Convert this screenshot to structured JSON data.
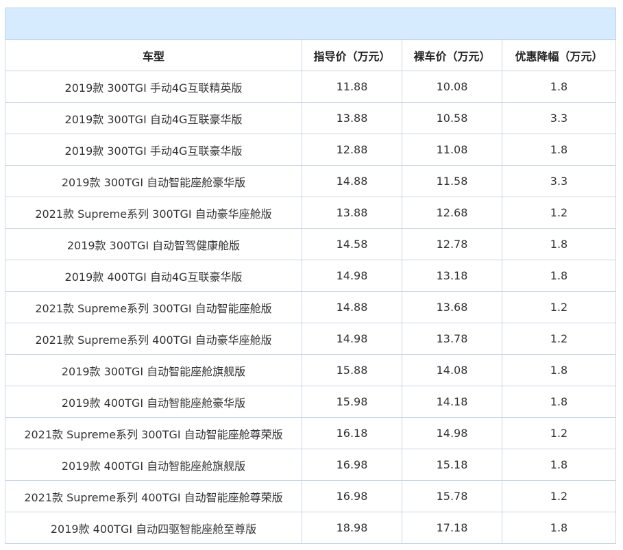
{
  "table": {
    "headers": [
      "车型",
      "指导价（万元）",
      "裸车价（万元）",
      "优惠降幅（万元）"
    ],
    "rows": [
      [
        "2019款 300TGI 手动4G互联精英版",
        "11.88",
        "10.08",
        "1.8"
      ],
      [
        "2019款 300TGI 自动4G互联豪华版",
        "13.88",
        "10.58",
        "3.3"
      ],
      [
        "2019款 300TGI 手动4G互联豪华版",
        "12.88",
        "11.08",
        "1.8"
      ],
      [
        "2019款 300TGI 自动智能座舱豪华版",
        "14.88",
        "11.58",
        "3.3"
      ],
      [
        "2021款 Supreme系列 300TGI 自动豪华座舱版",
        "13.88",
        "12.68",
        "1.2"
      ],
      [
        "2019款 300TGI 自动智驾健康舱版",
        "14.58",
        "12.78",
        "1.8"
      ],
      [
        "2019款 400TGI 自动4G互联豪华版",
        "14.98",
        "13.18",
        "1.8"
      ],
      [
        "2021款 Supreme系列 300TGI 自动智能座舱版",
        "14.88",
        "13.68",
        "1.2"
      ],
      [
        "2021款 Supreme系列 400TGI 自动豪华座舱版",
        "14.98",
        "13.78",
        "1.2"
      ],
      [
        "2019款 300TGI 自动智能座舱旗舰版",
        "15.88",
        "14.08",
        "1.8"
      ],
      [
        "2019款 400TGI 自动智能座舱豪华版",
        "15.98",
        "14.18",
        "1.8"
      ],
      [
        "2021款 Supreme系列 300TGI 自动智能座舱尊荣版",
        "16.18",
        "14.98",
        "1.2"
      ],
      [
        "2019款 400TGI 自动智能座舱旗舰版",
        "16.98",
        "15.18",
        "1.8"
      ],
      [
        "2021款 Supreme系列 400TGI 自动智能座舱尊荣版",
        "16.98",
        "15.78",
        "1.2"
      ],
      [
        "2019款 400TGI 自动四驱智能座舱至尊版",
        "18.98",
        "17.18",
        "1.8"
      ]
    ]
  }
}
